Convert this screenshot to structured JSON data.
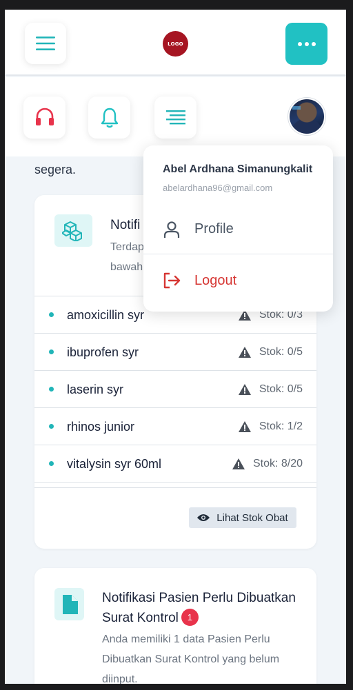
{
  "header": {
    "logo_text": "LOGO",
    "menu_icon": "hamburger-icon",
    "more_icon": "ellipsis-icon"
  },
  "subheader": {
    "icons": [
      "headset-icon",
      "bell-icon",
      "align-icon"
    ],
    "avatar": "user-avatar"
  },
  "intro": {
    "text_tail": "segera."
  },
  "stock_card": {
    "title": "Notifi",
    "desc_line1": "Terdap",
    "desc_line2": "bawah",
    "items": [
      {
        "name": "amoxicillin syr",
        "stock": "Stok: 0/3"
      },
      {
        "name": "ibuprofen syr",
        "stock": "Stok: 0/5"
      },
      {
        "name": "laserin syr",
        "stock": "Stok: 0/5"
      },
      {
        "name": "rhinos junior",
        "stock": "Stok: 1/2"
      },
      {
        "name": "vitalysin syr 60ml",
        "stock": "Stok: 8/20"
      }
    ],
    "view_button": "Lihat Stok Obat"
  },
  "patient_card": {
    "title": "Notifikasi Pasien Perlu Dibuatkan Surat Kontrol",
    "badge": "1",
    "desc": "Anda memiliki 1 data Pasien Perlu Dibuatkan Surat Kontrol yang belum diinput."
  },
  "dropdown": {
    "user_name": "Abel Ardhana Simanungkalit",
    "email": "abelardhana96@gmail.com",
    "profile_label": "Profile",
    "logout_label": "Logout"
  },
  "colors": {
    "accent": "#21c1c3",
    "logo": "#a61522",
    "headset": "#e8334b",
    "logout": "#d63633",
    "badge": "#e8334b"
  }
}
